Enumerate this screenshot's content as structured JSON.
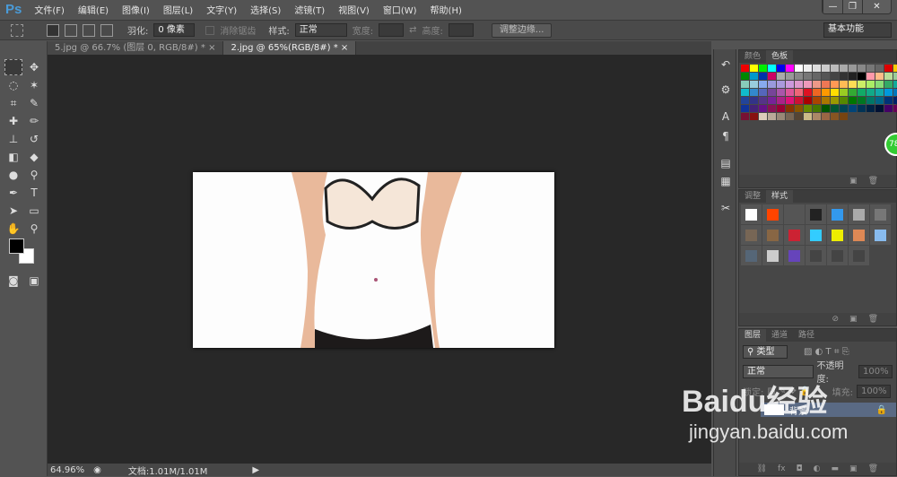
{
  "app": {
    "logo": "Ps"
  },
  "menu": [
    "文件(F)",
    "编辑(E)",
    "图像(I)",
    "图层(L)",
    "文字(Y)",
    "选择(S)",
    "滤镜(T)",
    "视图(V)",
    "窗口(W)",
    "帮助(H)"
  ],
  "window_buttons": {
    "minimize": "—",
    "restore": "❐",
    "close": "✕"
  },
  "options": {
    "feather_label": "羽化:",
    "feather_value": "0 像素",
    "antialias_label": "消除锯齿",
    "style_label": "样式:",
    "style_value": "正常",
    "width_label": "宽度:",
    "height_label": "高度:",
    "refine_edge": "调整边缘...",
    "workspace": "基本功能"
  },
  "tabs": [
    {
      "label": "5.jpg @ 66.7% (图层 0, RGB/8#) *",
      "close": "×"
    },
    {
      "label": "2.jpg @ 65%(RGB/8#) *",
      "close": "×"
    }
  ],
  "status": {
    "zoom": "64.96%",
    "doc": "文档:1.01M/1.01M"
  },
  "panels": {
    "color": {
      "tabs": [
        "颜色",
        "色板"
      ],
      "active": 1,
      "swatches": [
        "#e00",
        "#ff0",
        "#0e0",
        "#0ff",
        "#00e",
        "#f0f",
        "#fff",
        "#eee",
        "#ddd",
        "#ccc",
        "#bbb",
        "#aaa",
        "#999",
        "#888",
        "#777",
        "#666",
        "#d00",
        "#fc0",
        "#080",
        "#09c",
        "#03a",
        "#c06",
        "#aaa",
        "#999",
        "#888",
        "#777",
        "#666",
        "#555",
        "#444",
        "#333",
        "#222",
        "#000",
        "#f9a",
        "#fb8",
        "#bd9",
        "#9c9",
        "#8cb",
        "#9cd",
        "#8ae",
        "#99d",
        "#a9d",
        "#c9d",
        "#d9c",
        "#e9b",
        "#e98",
        "#e75",
        "#f95",
        "#fb5",
        "#fd5",
        "#ce6",
        "#ae6",
        "#8d7",
        "#3a6",
        "#1a9",
        "#1bc",
        "#38c",
        "#56b",
        "#749",
        "#a5a",
        "#d59",
        "#e67",
        "#d12",
        "#e62",
        "#f90",
        "#fd0",
        "#9c2",
        "#3a3",
        "#1a6",
        "#1a8",
        "#1aa",
        "#09d",
        "#07b",
        "#249",
        "#338",
        "#538",
        "#729",
        "#a28",
        "#d17",
        "#c13",
        "#a00",
        "#a40",
        "#a70",
        "#990",
        "#580",
        "#070",
        "#072",
        "#076",
        "#068",
        "#037",
        "#026",
        "#139",
        "#427",
        "#618",
        "#815",
        "#903",
        "#830",
        "#850",
        "#680",
        "#470",
        "#050",
        "#053",
        "#045",
        "#047",
        "#035",
        "#024",
        "#013",
        "#406",
        "#605",
        "#713",
        "#811",
        "#dcb",
        "#ba9",
        "#987",
        "#765",
        "#543",
        "#cb8",
        "#a86",
        "#964",
        "#852",
        "#741"
      ]
    },
    "styles": {
      "tabs": [
        "调整",
        "样式"
      ],
      "active": 1,
      "items": [
        "#fff",
        "#f40",
        "#555",
        "#222",
        "#39e",
        "#aaa",
        "#777",
        "#765",
        "#864",
        "#c23",
        "#3cf",
        "#ee0",
        "#d85",
        "#8be",
        "#567",
        "#ccc",
        "#64b",
        "#444",
        "#444",
        "#444"
      ]
    },
    "layers": {
      "tabs": [
        "图层",
        "通道",
        "路径"
      ],
      "active": 0,
      "filter": "类型",
      "blend": "正常",
      "opacity_label": "不透明度:",
      "opacity": "100%",
      "lock_label": "锁定:",
      "fill_label": "填充:",
      "fill": "100%",
      "layer_name": "背景"
    }
  },
  "watermark": {
    "brand": "Baidu经验",
    "url": "jingyan.baidu.com"
  },
  "badge": "78"
}
